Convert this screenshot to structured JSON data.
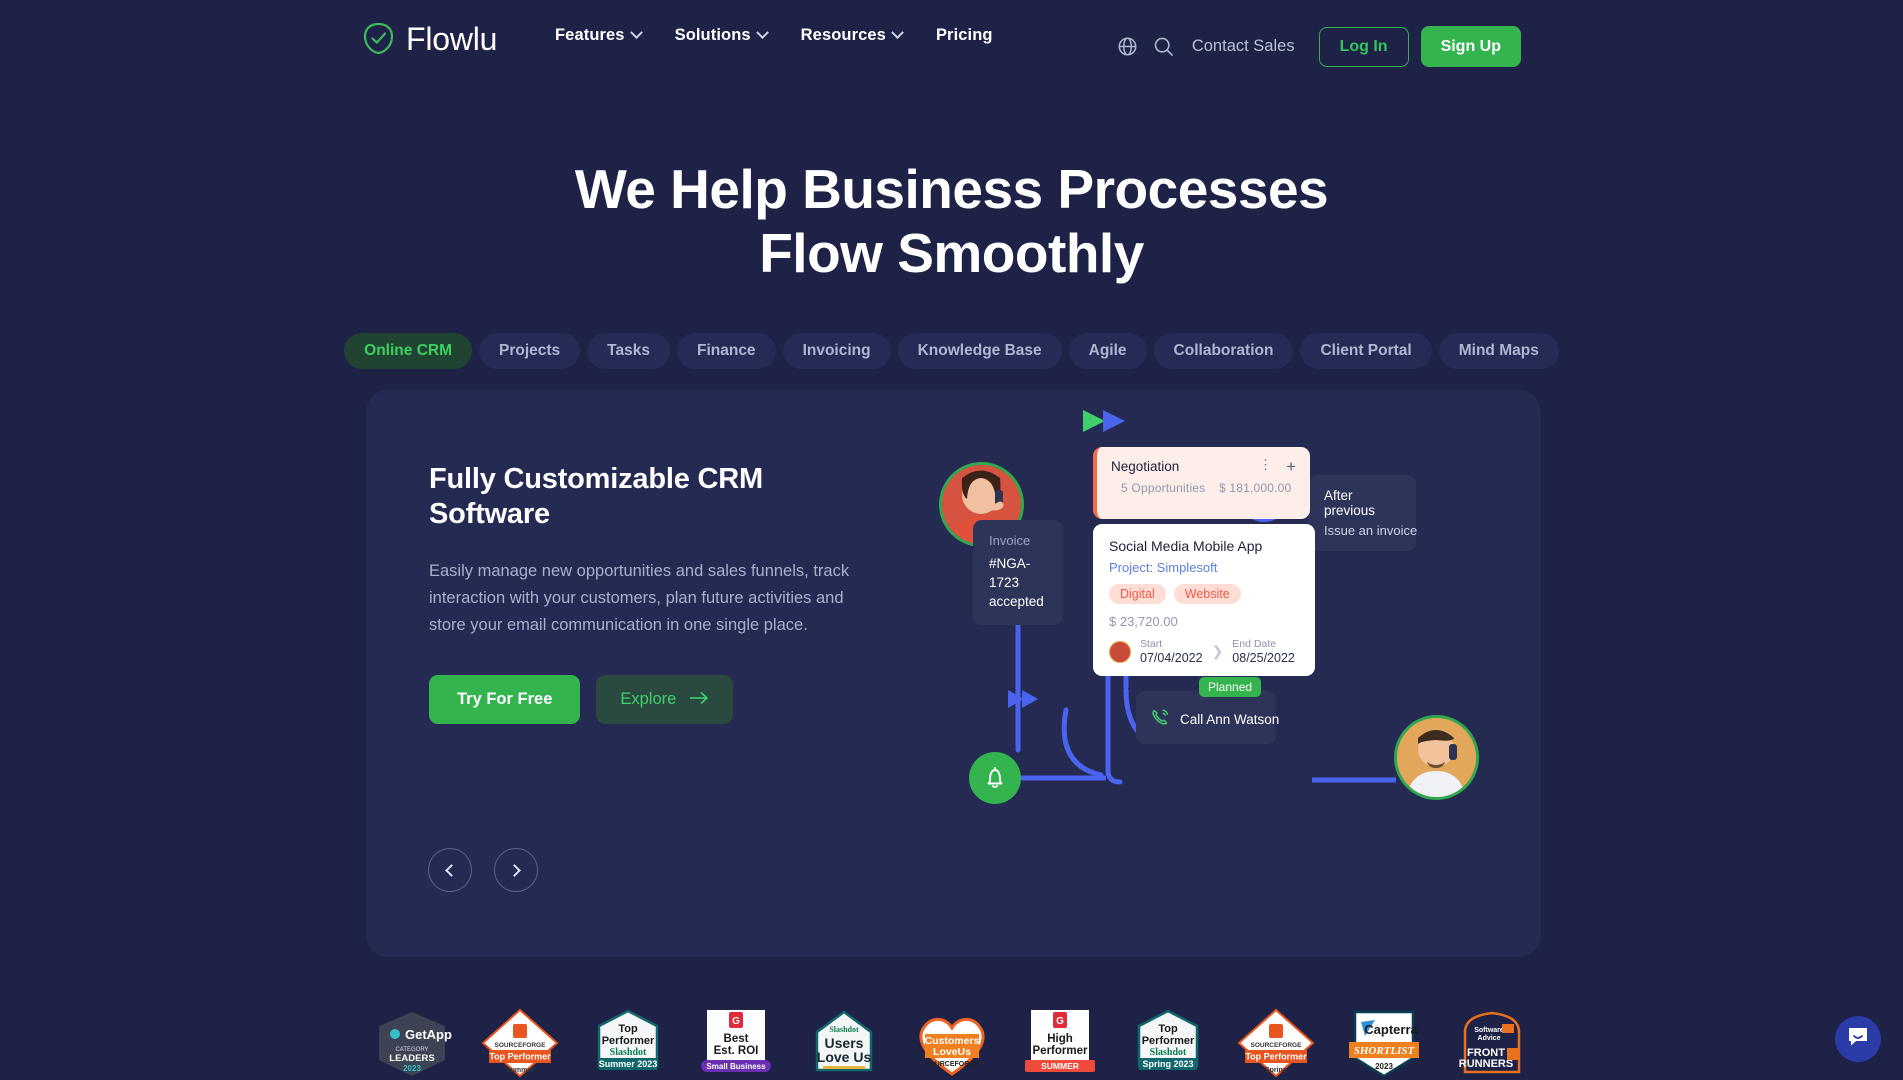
{
  "brand": {
    "name": "Flowlu",
    "logo_icon": "check-shield-icon",
    "accent_green": "#33b44f",
    "bg": "#1e2246"
  },
  "header": {
    "nav": [
      {
        "label": "Features",
        "has_caret": true
      },
      {
        "label": "Solutions",
        "has_caret": true
      },
      {
        "label": "Resources",
        "has_caret": true
      },
      {
        "label": "Pricing",
        "has_caret": false
      }
    ],
    "globe_icon": "globe-icon",
    "search_icon": "search-icon",
    "contact_sales": "Contact Sales",
    "login": "Log In",
    "signup": "Sign Up"
  },
  "hero": {
    "title_line1": "We Help Business Processes",
    "title_line2": "Flow Smoothly",
    "tabs": [
      {
        "label": "Online CRM",
        "active": true
      },
      {
        "label": "Projects",
        "active": false
      },
      {
        "label": "Tasks",
        "active": false
      },
      {
        "label": "Finance",
        "active": false
      },
      {
        "label": "Invoicing",
        "active": false
      },
      {
        "label": "Knowledge Base",
        "active": false
      },
      {
        "label": "Agile",
        "active": false
      },
      {
        "label": "Collaboration",
        "active": false
      },
      {
        "label": "Client Portal",
        "active": false
      },
      {
        "label": "Mind Maps",
        "active": false
      }
    ]
  },
  "panel": {
    "heading": "Fully Customizable CRM Software",
    "paragraph": "Easily manage new opportunities and sales funnels, track interaction with your customers, plan future activities and store your email communication in one single place.",
    "cta_primary": "Try For Free",
    "cta_secondary": "Explore",
    "cta_secondary_icon": "arrow-right-icon",
    "prev_icon": "chevron-left-icon",
    "next_icon": "chevron-right-icon"
  },
  "illustration": {
    "automation_tooltip": {
      "line1": "After previous",
      "line2": "Issue an invoice",
      "icon": "refresh-sync-icon"
    },
    "invoice_tooltip": {
      "caption": "Invoice",
      "line1": "#NGA-1723",
      "line2": "accepted",
      "icon": "bell-icon"
    },
    "negotiation_card": {
      "title": "Negotiation",
      "opportunities": "5 Opportunities",
      "amount": "$ 181,000.00",
      "menu_icon": "kebab-menu-icon",
      "add_icon": "plus-icon"
    },
    "deal_card": {
      "title": "Social Media Mobile App",
      "project": "Project: Simplesoft",
      "tags": [
        "Digital",
        "Website"
      ],
      "amount": "$ 23,720.00",
      "start_label": "Start",
      "start_date": "07/04/2022",
      "end_label": "End Date",
      "end_date": "08/25/2022",
      "avatar_icon": "user-avatar",
      "arrow_icon": "chevron-right-icon"
    },
    "task": {
      "status": "Planned",
      "title": "Call Ann Watson",
      "icon": "phone-call-icon"
    },
    "avatars": [
      {
        "name": "avatar-woman-calling"
      },
      {
        "name": "avatar-man-calling"
      }
    ]
  },
  "badges": [
    {
      "name": "getapp-category-leaders",
      "lines": [
        "GetApp",
        "CATEGORY",
        "LEADERS",
        "2023"
      ]
    },
    {
      "name": "sourceforge-top-performer-summer",
      "lines": [
        "SOURCEFORGE",
        "Top Performer",
        "Summer"
      ]
    },
    {
      "name": "slashdot-top-performer-summer-2023",
      "lines": [
        "Top",
        "Performer",
        "Slashdot",
        "Summer 2023"
      ]
    },
    {
      "name": "g2-best-est-roi-small-business",
      "lines": [
        "Best",
        "Est. ROI",
        "Small Business"
      ]
    },
    {
      "name": "slashdot-users-love-us",
      "lines": [
        "Slashdot",
        "Users",
        "Love Us"
      ]
    },
    {
      "name": "sourceforge-customers-love-us",
      "lines": [
        "Customers",
        "LoveUs",
        "SOURCEFORGE"
      ]
    },
    {
      "name": "g2-high-performer-summer",
      "lines": [
        "High",
        "Performer",
        "SUMMER"
      ]
    },
    {
      "name": "slashdot-top-performer-spring-2023",
      "lines": [
        "Top",
        "Performer",
        "Slashdot",
        "Spring 2023"
      ]
    },
    {
      "name": "sourceforge-top-performer-spring",
      "lines": [
        "SOURCEFORGE",
        "Top Performer",
        "Spring"
      ]
    },
    {
      "name": "capterra-shortlist-2023",
      "lines": [
        "Capterra",
        "SHORTLIST",
        "2023"
      ]
    },
    {
      "name": "software-advice-front-runners",
      "lines": [
        "Software",
        "Advice",
        "FRONT",
        "RUNNERS"
      ]
    }
  ],
  "chat": {
    "icon": "chat-bubble-icon"
  }
}
